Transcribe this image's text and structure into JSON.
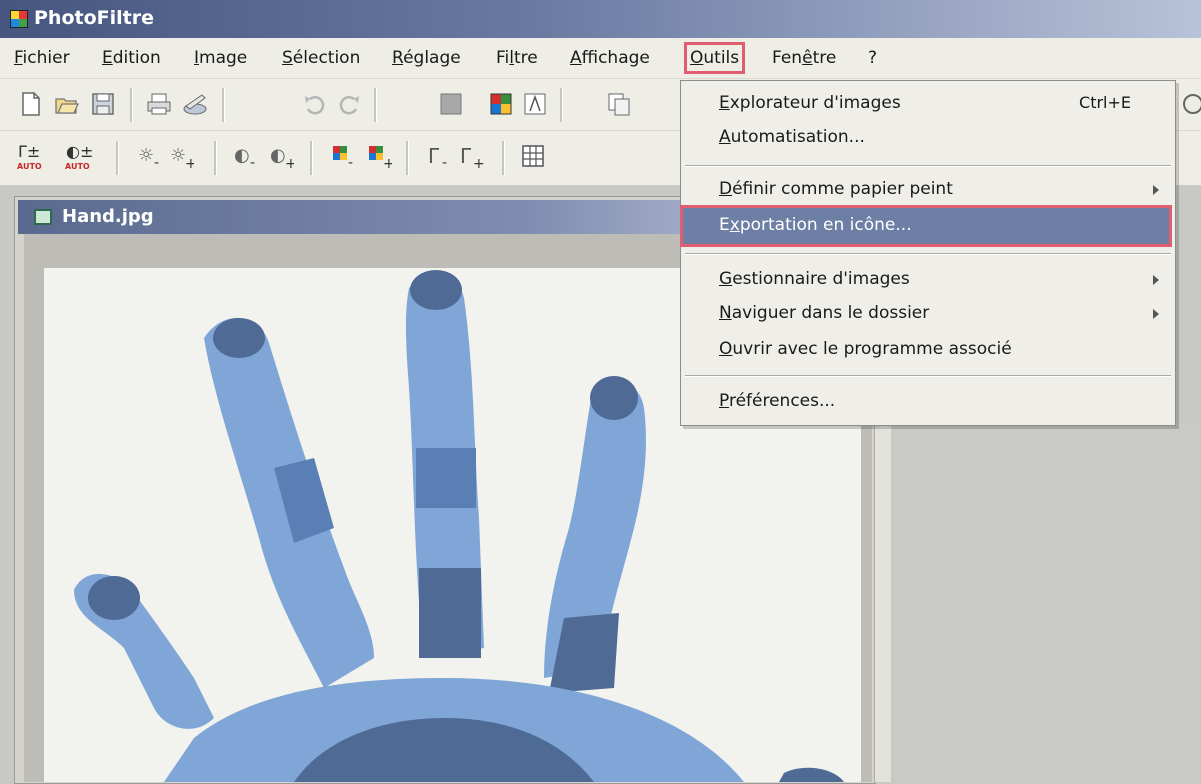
{
  "window": {
    "title": "PhotoFiltre"
  },
  "menubar": {
    "items": [
      {
        "pre": "",
        "key": "F",
        "post": "ichier"
      },
      {
        "pre": "",
        "key": "E",
        "post": "dition"
      },
      {
        "pre": "",
        "key": "I",
        "post": "mage"
      },
      {
        "pre": "",
        "key": "S",
        "post": "élection"
      },
      {
        "pre": "",
        "key": "R",
        "post": "églage"
      },
      {
        "pre": "Fi",
        "key": "l",
        "post": "tre"
      },
      {
        "pre": "",
        "key": "A",
        "post": "ffichage"
      },
      {
        "pre": "",
        "key": "O",
        "post": "utils"
      },
      {
        "pre": "Fen",
        "key": "ê",
        "post": "tre"
      },
      {
        "pre": "?",
        "key": "",
        "post": ""
      }
    ]
  },
  "toolbar1": {
    "icons": [
      "new-file-icon",
      "open-folder-icon",
      "save-icon",
      "print-icon",
      "scan-icon",
      "undo-icon",
      "redo-icon",
      "gray-icon",
      "colors-icon",
      "filter-icon",
      "copy-icon"
    ]
  },
  "toolbar2": {
    "auto_label": "AUTO",
    "icons": [
      "gamma-auto-icon",
      "contrast-auto-icon",
      "brightness-minus-icon",
      "brightness-plus-icon",
      "contrast-minus-icon",
      "contrast-plus-icon",
      "saturation-minus-icon",
      "saturation-plus-icon",
      "gamma-minus-icon",
      "gamma-plus-icon",
      "grid-icon"
    ]
  },
  "document": {
    "title": "Hand.jpg"
  },
  "dropdown": {
    "explorer": {
      "pre": "",
      "key": "E",
      "post": "xplorateur d'images",
      "shortcut": "Ctrl+E"
    },
    "automation": {
      "pre": "",
      "key": "A",
      "post": "utomatisation..."
    },
    "wallpaper": {
      "pre": "",
      "key": "D",
      "post": "éfinir comme papier peint"
    },
    "export_icon": {
      "pre": "E",
      "key": "x",
      "post": "portation en icône..."
    },
    "image_manager": {
      "pre": "",
      "key": "G",
      "post": "estionnaire d'images"
    },
    "browse_folder": {
      "pre": "",
      "key": "N",
      "post": "aviguer dans le dossier"
    },
    "open_with": {
      "pre": "",
      "key": "O",
      "post": "uvrir avec le programme associé"
    },
    "preferences": {
      "pre": "",
      "key": "P",
      "post": "références..."
    }
  },
  "colors": {
    "highlight": "#6d7fa5",
    "annotation": "#e05e70",
    "hand_light": "#7fa6d6",
    "hand_dark": "#4e6a95"
  }
}
